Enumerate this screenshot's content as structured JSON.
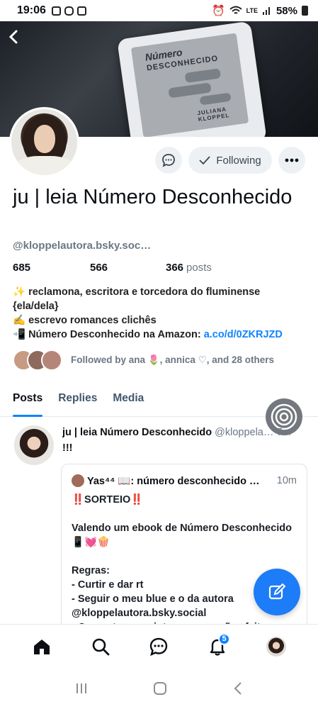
{
  "status_bar": {
    "time": "19:06",
    "network": "LTE",
    "battery": "58%",
    "icons": [
      "sim-icon",
      "message-icon",
      "instagram-icon",
      "gallery-icon",
      "alarm-icon",
      "wifi-icon",
      "signal-icon",
      "battery-icon"
    ]
  },
  "banner": {
    "back_icon": "back-arrow-icon",
    "book_title_line1": "Número",
    "book_title_line2": "DESCONHECIDO",
    "book_author": "JULIANA KLOPPEL",
    "device_brand": "kindle"
  },
  "profile": {
    "display_name": "ju | leia Número Desconhecido",
    "handle": "@kloppelautora.bsky.soc…",
    "followers": "685",
    "following": "566",
    "posts_count": "366",
    "posts_label": "posts",
    "bio_line1": "✨ reclamona, escritora e torcedora do fluminense {ela/dela}",
    "bio_line2": "✍️ escrevo romances clichês",
    "bio_line3_text": "📲 Número Desconhecido na Amazon: ",
    "bio_line3_link": "a.co/d/0ZKRJZD",
    "followed_by": "Followed by ana 🌷, annica ♡, and 28 others"
  },
  "actions": {
    "message_icon": "chat-bubble-icon",
    "following_label": "Following",
    "more_icon": "ellipsis-icon"
  },
  "tabs": [
    {
      "label": "Posts",
      "active": true
    },
    {
      "label": "Replies",
      "active": false
    },
    {
      "label": "Media",
      "active": false
    }
  ],
  "post": {
    "author_name": "ju | leia Número Desconhecido",
    "author_handle": "@kloppela…",
    "time": "7m",
    "text": "!!!",
    "quote": {
      "author_name": "Yas⁴⁴ 📖: número desconhecido …",
      "time": "10m",
      "body": "‼️SORTEIO‼️\n\nValendo um ebook de Número Desconhecido📱💓🍿\n\nRegras:\n- Curtir e dar rt\n- Seguir o meu blue e o da autora @kloppelautora.bsky.social\n- Comentar os prints com as ações feitas"
    }
  },
  "bottom_nav": {
    "items": [
      "home-icon",
      "search-icon",
      "chat-icon",
      "notifications-icon",
      "profile-avatar"
    ],
    "notification_count": "5"
  },
  "colors": {
    "accent": "#1083fe",
    "compose_button": "#1d7cf7",
    "muted_text": "#6b7785",
    "button_bg": "#eef1f4"
  }
}
